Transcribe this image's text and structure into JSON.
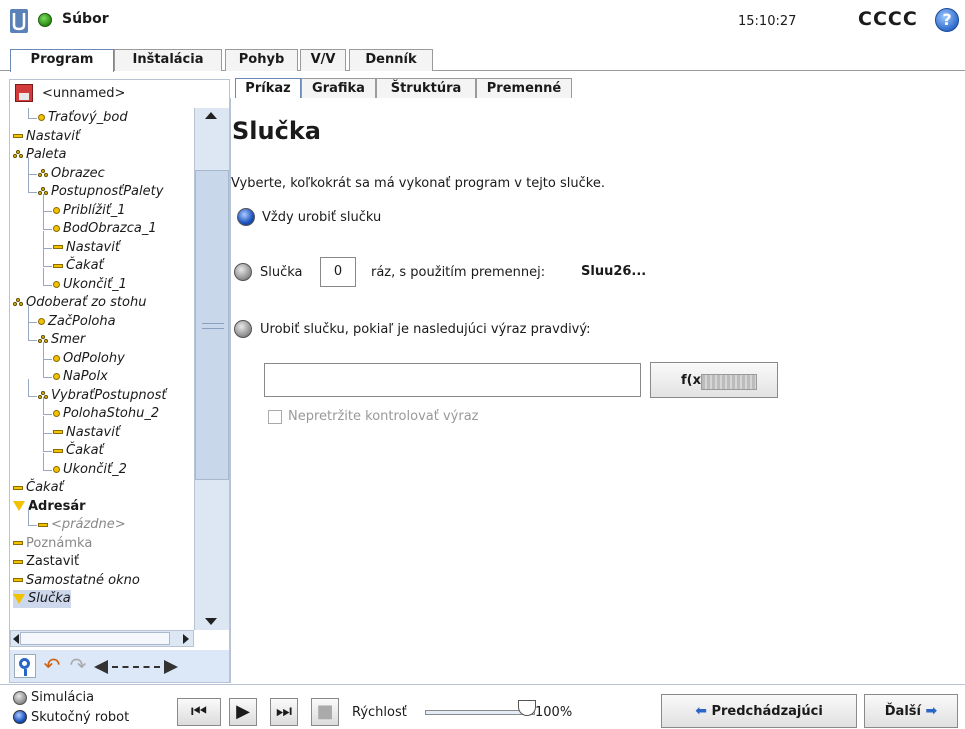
{
  "header": {
    "file_label": "Súbor",
    "clock": "15:10:27",
    "robot_name": "CCCC",
    "help_symbol": "?"
  },
  "main_tabs": [
    {
      "label": "Program",
      "active": true
    },
    {
      "label": "Inštalácia",
      "active": false
    },
    {
      "label": "Pohyb",
      "active": false
    },
    {
      "label": "V/V",
      "active": false
    },
    {
      "label": "Denník",
      "active": false
    }
  ],
  "program": {
    "name": "<unnamed>"
  },
  "tree": [
    {
      "label": "Traťový_bod",
      "icon": "waypoint"
    },
    {
      "label": "Nastaviť",
      "icon": "bar"
    },
    {
      "label": "Paleta",
      "icon": "pallet"
    },
    {
      "label": "Obrazec",
      "icon": "pallet"
    },
    {
      "label": "PostupnosťPalety",
      "icon": "pallet"
    },
    {
      "label": "Priblížiť_1",
      "icon": "waypoint"
    },
    {
      "label": "BodObrazca_1",
      "icon": "waypoint"
    },
    {
      "label": "Nastaviť",
      "icon": "bar"
    },
    {
      "label": "Čakať",
      "icon": "bar"
    },
    {
      "label": "Ukončiť_1",
      "icon": "waypoint"
    },
    {
      "label": "Odoberať zo stohu",
      "icon": "pallet"
    },
    {
      "label": "ZačPoloha",
      "icon": "waypoint"
    },
    {
      "label": "Smer",
      "icon": "pallet"
    },
    {
      "label": "OdPolohy",
      "icon": "waypoint"
    },
    {
      "label": "NaPolx",
      "icon": "waypoint"
    },
    {
      "label": "VybraťPostupnosť",
      "icon": "pallet"
    },
    {
      "label": "PolohaStohu_2",
      "icon": "waypoint"
    },
    {
      "label": "Nastaviť",
      "icon": "bar"
    },
    {
      "label": "Čakať",
      "icon": "bar"
    },
    {
      "label": "Ukončiť_2",
      "icon": "waypoint"
    },
    {
      "label": "Čakať",
      "icon": "bar"
    },
    {
      "label": "Adresár",
      "icon": "folder"
    },
    {
      "label": "<prázdne>",
      "icon": "bar"
    },
    {
      "label": "Poznámka",
      "icon": "bar"
    },
    {
      "label": "Zastaviť",
      "icon": "bar"
    },
    {
      "label": "Samostatné okno",
      "icon": "bar"
    },
    {
      "label": "Slučka",
      "icon": "folder"
    }
  ],
  "command_tabs": [
    {
      "label": "Príkaz",
      "active": true
    },
    {
      "label": "Grafika",
      "active": false
    },
    {
      "label": "Štruktúra",
      "active": false
    },
    {
      "label": "Premenné",
      "active": false
    }
  ],
  "loop": {
    "title": "Slučka",
    "description": "Vyberte, koľkokrát sa má vykonať program v tejto slučke.",
    "option_always": "Vždy urobiť slučku",
    "option_count_prefix": "Slučka",
    "count_value": "0",
    "option_count_suffix": "ráz, s použitím premennej:",
    "variable_name": "Sluu26...",
    "option_expr": "Urobiť slučku, pokiaľ je nasledujúci výraz pravdivý:",
    "expr_value": "",
    "fx_label": "f(x)",
    "continuous_check_label": "Nepretržite kontrolovať výraz",
    "selected_option": "always"
  },
  "footer": {
    "mode_sim": "Simulácia",
    "mode_real": "Skutočný robot",
    "speed_label": "Rýchlosť",
    "speed_value": "100%",
    "speed_fraction": 1.0,
    "prev_label": "Predchádzajúci",
    "next_label": "Ďalší"
  },
  "colors": {
    "accent": "#2a66c8",
    "selection": "#cdd8ec",
    "node_yellow": "#f2c200"
  }
}
